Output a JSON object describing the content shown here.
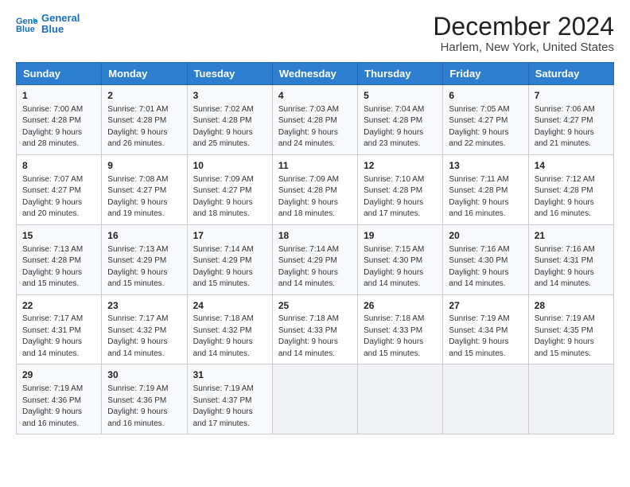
{
  "header": {
    "logo_line1": "General",
    "logo_line2": "Blue",
    "title": "December 2024",
    "subtitle": "Harlem, New York, United States"
  },
  "days_of_week": [
    "Sunday",
    "Monday",
    "Tuesday",
    "Wednesday",
    "Thursday",
    "Friday",
    "Saturday"
  ],
  "weeks": [
    [
      {
        "day": "1",
        "sunrise": "7:00 AM",
        "sunset": "4:28 PM",
        "daylight": "9 hours and 28 minutes."
      },
      {
        "day": "2",
        "sunrise": "7:01 AM",
        "sunset": "4:28 PM",
        "daylight": "9 hours and 26 minutes."
      },
      {
        "day": "3",
        "sunrise": "7:02 AM",
        "sunset": "4:28 PM",
        "daylight": "9 hours and 25 minutes."
      },
      {
        "day": "4",
        "sunrise": "7:03 AM",
        "sunset": "4:28 PM",
        "daylight": "9 hours and 24 minutes."
      },
      {
        "day": "5",
        "sunrise": "7:04 AM",
        "sunset": "4:28 PM",
        "daylight": "9 hours and 23 minutes."
      },
      {
        "day": "6",
        "sunrise": "7:05 AM",
        "sunset": "4:27 PM",
        "daylight": "9 hours and 22 minutes."
      },
      {
        "day": "7",
        "sunrise": "7:06 AM",
        "sunset": "4:27 PM",
        "daylight": "9 hours and 21 minutes."
      }
    ],
    [
      {
        "day": "8",
        "sunrise": "7:07 AM",
        "sunset": "4:27 PM",
        "daylight": "9 hours and 20 minutes."
      },
      {
        "day": "9",
        "sunrise": "7:08 AM",
        "sunset": "4:27 PM",
        "daylight": "9 hours and 19 minutes."
      },
      {
        "day": "10",
        "sunrise": "7:09 AM",
        "sunset": "4:27 PM",
        "daylight": "9 hours and 18 minutes."
      },
      {
        "day": "11",
        "sunrise": "7:09 AM",
        "sunset": "4:28 PM",
        "daylight": "9 hours and 18 minutes."
      },
      {
        "day": "12",
        "sunrise": "7:10 AM",
        "sunset": "4:28 PM",
        "daylight": "9 hours and 17 minutes."
      },
      {
        "day": "13",
        "sunrise": "7:11 AM",
        "sunset": "4:28 PM",
        "daylight": "9 hours and 16 minutes."
      },
      {
        "day": "14",
        "sunrise": "7:12 AM",
        "sunset": "4:28 PM",
        "daylight": "9 hours and 16 minutes."
      }
    ],
    [
      {
        "day": "15",
        "sunrise": "7:13 AM",
        "sunset": "4:28 PM",
        "daylight": "9 hours and 15 minutes."
      },
      {
        "day": "16",
        "sunrise": "7:13 AM",
        "sunset": "4:29 PM",
        "daylight": "9 hours and 15 minutes."
      },
      {
        "day": "17",
        "sunrise": "7:14 AM",
        "sunset": "4:29 PM",
        "daylight": "9 hours and 15 minutes."
      },
      {
        "day": "18",
        "sunrise": "7:14 AM",
        "sunset": "4:29 PM",
        "daylight": "9 hours and 14 minutes."
      },
      {
        "day": "19",
        "sunrise": "7:15 AM",
        "sunset": "4:30 PM",
        "daylight": "9 hours and 14 minutes."
      },
      {
        "day": "20",
        "sunrise": "7:16 AM",
        "sunset": "4:30 PM",
        "daylight": "9 hours and 14 minutes."
      },
      {
        "day": "21",
        "sunrise": "7:16 AM",
        "sunset": "4:31 PM",
        "daylight": "9 hours and 14 minutes."
      }
    ],
    [
      {
        "day": "22",
        "sunrise": "7:17 AM",
        "sunset": "4:31 PM",
        "daylight": "9 hours and 14 minutes."
      },
      {
        "day": "23",
        "sunrise": "7:17 AM",
        "sunset": "4:32 PM",
        "daylight": "9 hours and 14 minutes."
      },
      {
        "day": "24",
        "sunrise": "7:18 AM",
        "sunset": "4:32 PM",
        "daylight": "9 hours and 14 minutes."
      },
      {
        "day": "25",
        "sunrise": "7:18 AM",
        "sunset": "4:33 PM",
        "daylight": "9 hours and 14 minutes."
      },
      {
        "day": "26",
        "sunrise": "7:18 AM",
        "sunset": "4:33 PM",
        "daylight": "9 hours and 15 minutes."
      },
      {
        "day": "27",
        "sunrise": "7:19 AM",
        "sunset": "4:34 PM",
        "daylight": "9 hours and 15 minutes."
      },
      {
        "day": "28",
        "sunrise": "7:19 AM",
        "sunset": "4:35 PM",
        "daylight": "9 hours and 15 minutes."
      }
    ],
    [
      {
        "day": "29",
        "sunrise": "7:19 AM",
        "sunset": "4:36 PM",
        "daylight": "9 hours and 16 minutes."
      },
      {
        "day": "30",
        "sunrise": "7:19 AM",
        "sunset": "4:36 PM",
        "daylight": "9 hours and 16 minutes."
      },
      {
        "day": "31",
        "sunrise": "7:19 AM",
        "sunset": "4:37 PM",
        "daylight": "9 hours and 17 minutes."
      },
      null,
      null,
      null,
      null
    ]
  ],
  "labels": {
    "sunrise": "Sunrise:",
    "sunset": "Sunset:",
    "daylight": "Daylight:"
  }
}
